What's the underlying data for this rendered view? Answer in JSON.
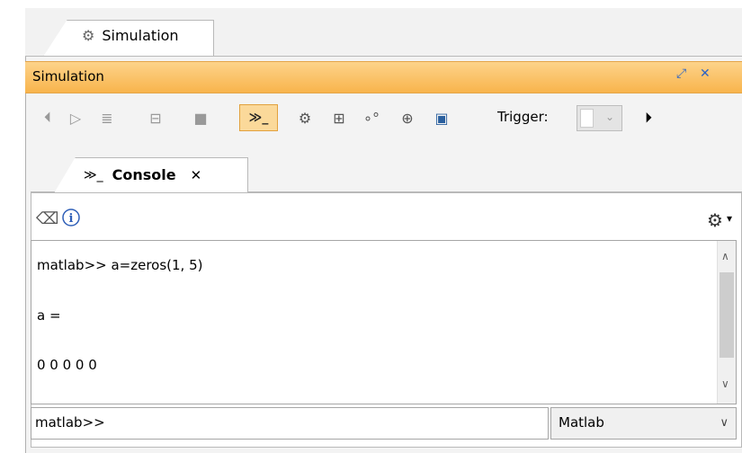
{
  "outer_tab": {
    "label": "Simulation",
    "icon": "simulation-gear-icon"
  },
  "panel": {
    "title": "Simulation",
    "restore_icon": "restore-icon",
    "close_icon": "close-icon"
  },
  "toolbar": {
    "buttons": [
      {
        "name": "step-back-icon",
        "glyph": "⏴"
      },
      {
        "name": "step-forward-icon",
        "glyph": "▷"
      },
      {
        "name": "step-into-icon",
        "glyph": "≣"
      },
      {
        "name": "step-over-icon",
        "glyph": "⊟"
      },
      {
        "name": "stop-icon",
        "glyph": "■"
      },
      {
        "name": "console-icon",
        "glyph": "≫_"
      },
      {
        "name": "simulation-icon",
        "glyph": "⚙"
      },
      {
        "name": "tree-icon",
        "glyph": "⊞"
      },
      {
        "name": "nodes-icon",
        "glyph": "∘"
      },
      {
        "name": "lock-icon",
        "glyph": "⊕"
      },
      {
        "name": "export-icon",
        "glyph": "▣"
      }
    ],
    "trigger_label": "Trigger:",
    "more_icon": "chevron-right-icon"
  },
  "console_tab": {
    "icon_text": "≫_",
    "label": "Console",
    "close": "✕"
  },
  "console_toolbar": {
    "clear_icon": "eraser-icon",
    "info_icon": "info-icon",
    "settings_icon": "gear-icon",
    "dropdown_icon": "chevron-down-icon"
  },
  "output": {
    "lines": [
      "matlab>> a=zeros(1, 5)",
      "a =",
      "0 0 0 0 0"
    ]
  },
  "input": {
    "value": "matlab>>"
  },
  "language_select": {
    "selected": "Matlab"
  },
  "colors": {
    "header_gradient_top": "#fdd38a",
    "header_gradient_bottom": "#f8b44c",
    "active_button": "#fbd99a"
  }
}
